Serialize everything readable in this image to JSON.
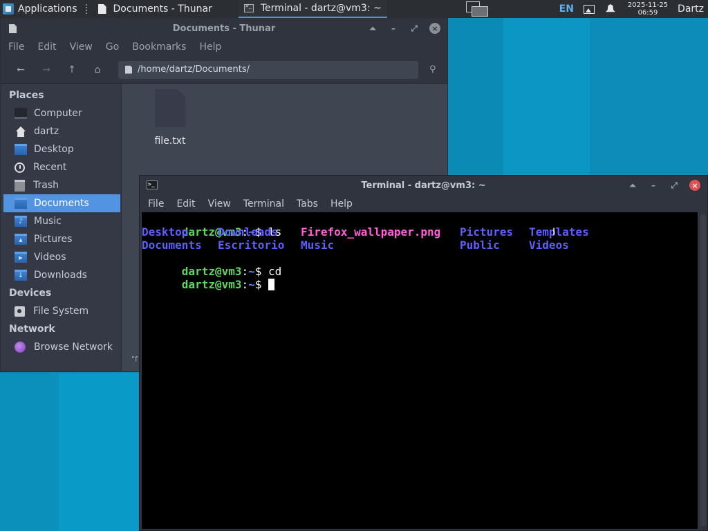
{
  "panel": {
    "applications_label": "Applications",
    "tasks": [
      {
        "label": "Documents - Thunar"
      },
      {
        "label": "Terminal - dartz@vm3: ~"
      }
    ],
    "language": "EN",
    "clock_date": "2025-11-25",
    "clock_time": "06:59",
    "user": "Dartz"
  },
  "thunar": {
    "title": "Documents - Thunar",
    "menu": [
      "File",
      "Edit",
      "View",
      "Go",
      "Bookmarks",
      "Help"
    ],
    "path": "/home/dartz/Documents/",
    "sidebar": {
      "places_header": "Places",
      "places": [
        "Computer",
        "dartz",
        "Desktop",
        "Recent",
        "Trash",
        "Documents",
        "Music",
        "Pictures",
        "Videos",
        "Downloads"
      ],
      "selected": "Documents",
      "devices_header": "Devices",
      "devices": [
        "File System"
      ],
      "network_header": "Network",
      "network": [
        "Browse Network"
      ]
    },
    "files": [
      {
        "name": "file.txt"
      }
    ],
    "status_snippet": "\"f"
  },
  "terminal": {
    "title": "Terminal - dartz@vm3: ~",
    "menu": [
      "File",
      "Edit",
      "View",
      "Terminal",
      "Tabs",
      "Help"
    ],
    "prompt_user": "dartz@vm3",
    "prompt_sep": ":",
    "prompt_dir": "~",
    "prompt_end": "$ ",
    "commands": [
      "ls",
      "cd",
      ""
    ],
    "ls_row1": [
      "Desktop",
      "Downloads",
      "Firefox_wallpaper.png",
      "Pictures",
      "Templates"
    ],
    "ls_row2": [
      "Documents",
      "Escritorio",
      "Music",
      "",
      "Public",
      "Videos"
    ]
  },
  "colors": {
    "accent": "#5294e2",
    "prompt_user": "#5fd75f",
    "dir_entry": "#5f5fff",
    "image_entry": "#ff5fd7",
    "close_button": "#e25252"
  }
}
